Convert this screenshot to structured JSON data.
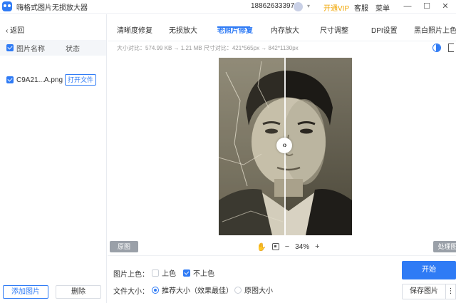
{
  "titlebar": {
    "app_title": "嗨格式图片无损放大器",
    "phone": "18862633397",
    "vip_label": "开通VIP",
    "service_label": "客服",
    "menu_label": "菜单",
    "minimize_glyph": "—",
    "maximize_glyph": "☐",
    "close_glyph": "✕",
    "caret_glyph": "▾"
  },
  "sidebar": {
    "back_label": "返回",
    "back_glyph": "‹",
    "col_name": "图片名称",
    "col_status": "状态",
    "files": [
      {
        "name": "C9A21...A.png",
        "action": "打开文件",
        "checked": true
      }
    ],
    "add_label": "添加图片",
    "delete_label": "删除"
  },
  "tabs": [
    {
      "label": "清晰度修复",
      "active": false
    },
    {
      "label": "无损放大",
      "active": false
    },
    {
      "label": "老照片修复",
      "active": true
    },
    {
      "label": "内存放大",
      "active": false
    },
    {
      "label": "尺寸调整",
      "active": false
    },
    {
      "label": "DPI设置",
      "active": false
    },
    {
      "label": "黑白照片上色",
      "active": false
    }
  ],
  "size_info": "大小对比：574.99 KB → 1.21 MB    尺寸对比：421*565px → 842*1130px",
  "preview": {
    "handle_glyph": "‹›",
    "original_tag": "原图",
    "processed_tag": "处理图",
    "hand_glyph": "✋",
    "zoom_minus": "−",
    "zoom_level": "34%",
    "zoom_plus": "+"
  },
  "options": {
    "colorize_label": "图片上色：",
    "colorize_yes": "上色",
    "colorize_no": "不上色",
    "colorize_selected": "不上色",
    "filesize_label": "文件大小：",
    "filesize_recommended": "推荐大小（效果最佳）",
    "filesize_original": "原图大小",
    "filesize_selected": "推荐大小（效果最佳）"
  },
  "actions": {
    "start_label": "开始",
    "save_label": "保存图片",
    "more_glyph": "⋮"
  },
  "colors": {
    "accent": "#2f7bf5",
    "vip": "#f0a500"
  }
}
